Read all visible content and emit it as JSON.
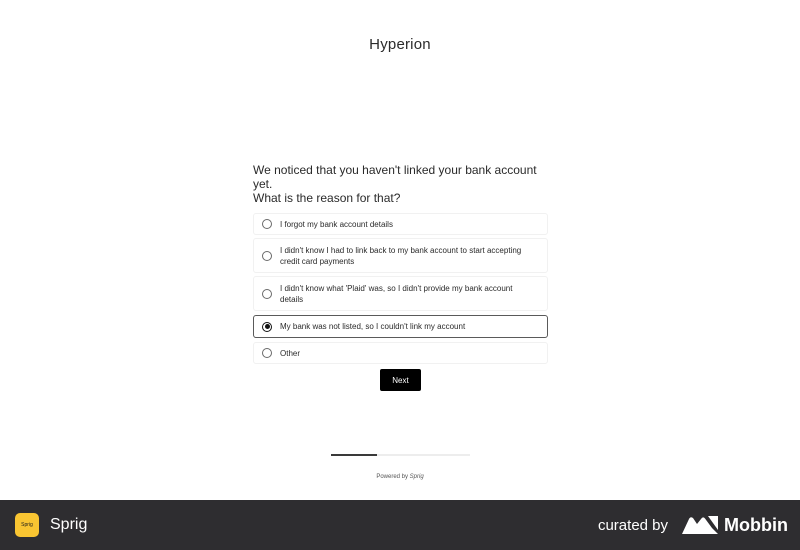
{
  "app": {
    "title": "Hyperion"
  },
  "survey": {
    "question_line1": "We noticed that you haven't linked your bank account yet.",
    "question_line2": "What is the reason for that?",
    "options": [
      {
        "label": "I forgot my bank account details",
        "selected": false
      },
      {
        "label": "I didn't know I had to link back to my bank account to start accepting credit card payments",
        "selected": false
      },
      {
        "label": "I didn't know what 'Plaid' was, so I didn't provide my bank account details",
        "selected": false
      },
      {
        "label": "My bank was not listed, so I couldn't link my account",
        "selected": true
      },
      {
        "label": "Other",
        "selected": false
      }
    ],
    "next_label": "Next"
  },
  "progress": {
    "fraction": 0.33
  },
  "powered_by": {
    "prefix": "Powered by",
    "brand": "Sprig"
  },
  "footer": {
    "logo_text": "Sprig",
    "brand_name": "Sprig",
    "curated_text": "curated by",
    "curator_name": "Mobbin",
    "colors": {
      "bar": "#2e2d30",
      "sprig_yellow": "#f9c532"
    }
  }
}
